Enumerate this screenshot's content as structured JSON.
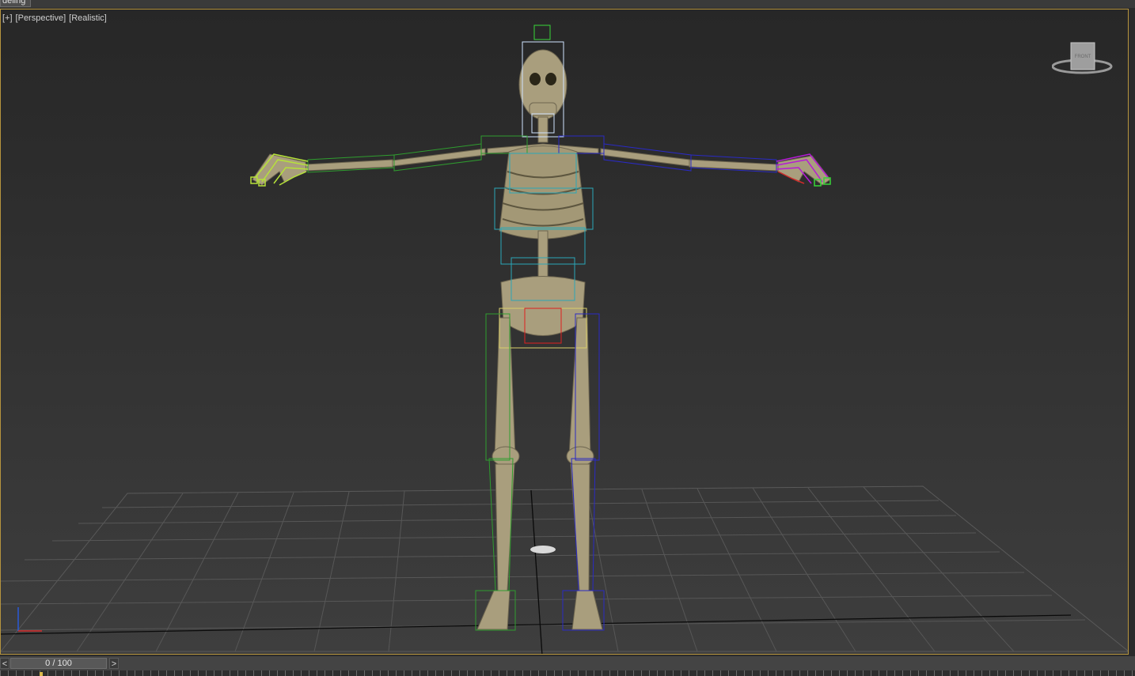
{
  "app": {
    "mode_tab": "deling"
  },
  "viewport": {
    "labels": [
      "[+]",
      "[Perspective]",
      "[Realistic]"
    ],
    "viewcube_face": "FRONT",
    "active_border_color": "#b6943e",
    "bone_colors": {
      "spine": "#2aa7b8",
      "left_arm": "#2f9d2f",
      "right_arm": "#2a2ac4",
      "left_hand": "#b6e23a",
      "right_hand": "#b51bd6",
      "pelvis": "#d9cf6a",
      "head": "#cfe3ff"
    },
    "axis_icons": [
      "z-axis-icon",
      "x-axis-icon"
    ]
  },
  "timeline": {
    "prev_label": "<",
    "next_label": ">",
    "frame_display": "0 / 100"
  }
}
